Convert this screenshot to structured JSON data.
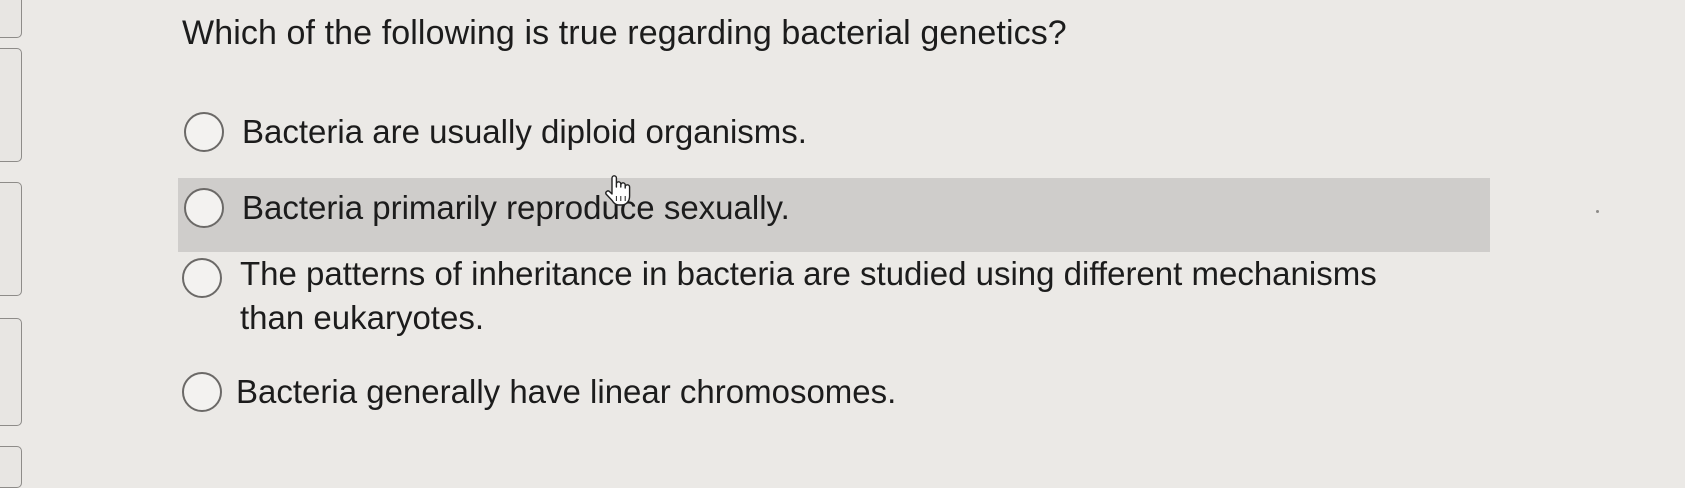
{
  "question": {
    "text": "Which of the following is true regarding bacterial genetics?"
  },
  "options": [
    {
      "label": "Bacteria are usually diploid organisms.",
      "selected": false,
      "hovered": false
    },
    {
      "label": "Bacteria primarily reproduce sexually.",
      "selected": false,
      "hovered": true
    },
    {
      "label_line1": "The patterns of inheritance in bacteria are studied using different mechanisms",
      "label_line2": "than eukaryotes.",
      "selected": false,
      "hovered": false
    },
    {
      "label": "Bacteria generally have linear chromosomes.",
      "selected": false,
      "hovered": false
    }
  ],
  "cursor": {
    "icon": "hand-pointer-icon"
  },
  "colors": {
    "background": "#ebe9e6",
    "hover_row": "#cfcdcb",
    "radio_border": "#6b6967",
    "text": "#1c1c1c"
  }
}
